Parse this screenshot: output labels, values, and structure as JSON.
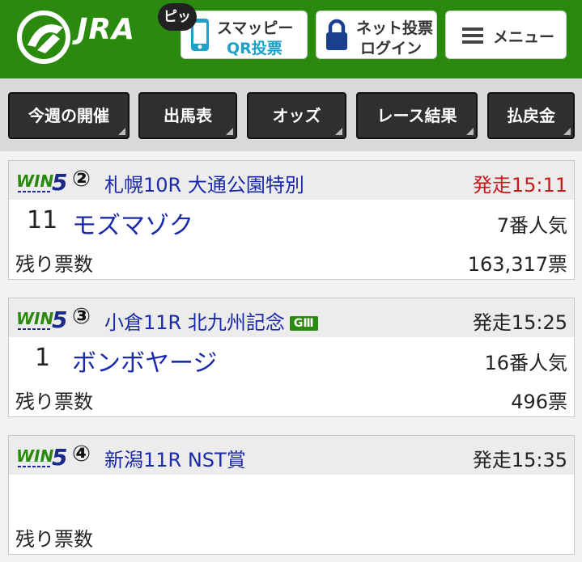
{
  "header": {
    "brand": "JRA",
    "pip_badge": "ピッ",
    "smappy_line1": "スマッピー",
    "smappy_line2": "QR投票",
    "net_line1": "ネット投票",
    "net_line2": "ログイン",
    "menu_label": "メニュー",
    "brand_color": "#2a8a0e"
  },
  "nav": {
    "items": [
      "今週の開催",
      "出馬表",
      "オッズ",
      "レース結果",
      "払戻金"
    ]
  },
  "cards": [
    {
      "leg": "②",
      "race": "札幌10R 大通公園特別",
      "grade": "",
      "post": "発走15:11",
      "number": "11",
      "horse": "モズマゾク",
      "popularity": "7番人気",
      "remaining_label": "残り票数",
      "remaining": "163,317票"
    },
    {
      "leg": "③",
      "race": "小倉11R 北九州記念",
      "grade": "GⅢ",
      "post": "発走15:25",
      "number": "1",
      "horse": "ボンボヤージ",
      "popularity": "16番人気",
      "remaining_label": "残り票数",
      "remaining": "496票"
    },
    {
      "leg": "④",
      "race": "新潟11R NST賞",
      "grade": "",
      "post": "発走15:35",
      "number": "",
      "horse": "",
      "popularity": "",
      "remaining_label": "残り票数",
      "remaining": ""
    }
  ]
}
